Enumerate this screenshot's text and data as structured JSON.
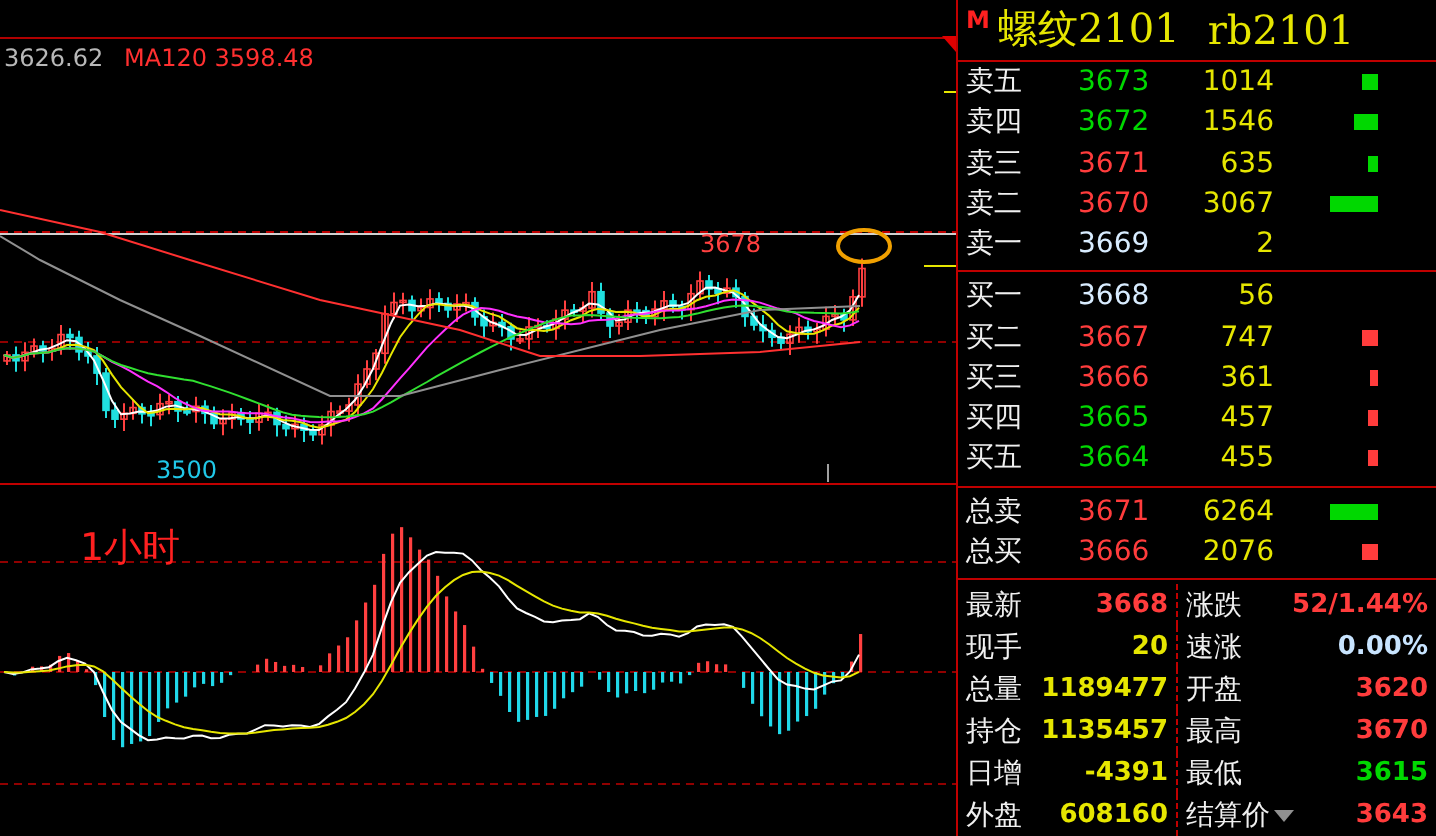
{
  "chart": {
    "ma_legend": [
      {
        "text": "3626.62",
        "color": "#b8b8b8"
      },
      {
        "text": "MA120 3598.48",
        "color": "#ff3030"
      }
    ],
    "high_label": "3678",
    "low_label": "3500",
    "period_label": "1小时"
  },
  "quote": {
    "badge": "M",
    "name": "螺纹2101",
    "code": "rb2101",
    "asks": [
      {
        "label": "卖五",
        "price": "3673",
        "color": "#00d800",
        "volume": "1014"
      },
      {
        "label": "卖四",
        "price": "3672",
        "color": "#00d800",
        "volume": "1546"
      },
      {
        "label": "卖三",
        "price": "3671",
        "color": "#ff3c3c",
        "volume": "635"
      },
      {
        "label": "卖二",
        "price": "3670",
        "color": "#ff3c3c",
        "volume": "3067"
      },
      {
        "label": "卖一",
        "price": "3669",
        "color": "#d8ecff",
        "volume": "2"
      }
    ],
    "bids": [
      {
        "label": "买一",
        "price": "3668",
        "color": "#d8ecff",
        "volume": "56"
      },
      {
        "label": "买二",
        "price": "3667",
        "color": "#ff3c3c",
        "volume": "747"
      },
      {
        "label": "买三",
        "price": "3666",
        "color": "#ff3c3c",
        "volume": "361"
      },
      {
        "label": "买四",
        "price": "3665",
        "color": "#00d800",
        "volume": "457"
      },
      {
        "label": "买五",
        "price": "3664",
        "color": "#00d800",
        "volume": "455"
      }
    ],
    "totals": [
      {
        "label": "总卖",
        "price": "3671",
        "color": "#ff3c3c",
        "volume": "6264"
      },
      {
        "label": "总买",
        "price": "3666",
        "color": "#ff3c3c",
        "volume": "2076"
      }
    ],
    "stats": [
      {
        "label": "最新",
        "value": "3668",
        "color": "#ff3c3c"
      },
      {
        "label": "涨跌",
        "value": "52/1.44%",
        "color": "#ff3c3c"
      },
      {
        "label": "现手",
        "value": "20",
        "color": "#e6e600"
      },
      {
        "label": "速涨",
        "value": "0.00%",
        "color": "#c8e4ff"
      },
      {
        "label": "总量",
        "value": "1189477",
        "color": "#e6e600"
      },
      {
        "label": "开盘",
        "value": "3620",
        "color": "#ff3c3c"
      },
      {
        "label": "持仓",
        "value": "1135457",
        "color": "#e6e600"
      },
      {
        "label": "最高",
        "value": "3670",
        "color": "#ff3c3c"
      },
      {
        "label": "日增",
        "value": "-4391",
        "color": "#e6e600"
      },
      {
        "label": "最低",
        "value": "3615",
        "color": "#00d800"
      },
      {
        "label": "外盘",
        "value": "608160",
        "color": "#e6e600"
      },
      {
        "label": "结算价",
        "value": "3643",
        "color": "#ff3c3c",
        "dropdown": true
      }
    ]
  }
}
